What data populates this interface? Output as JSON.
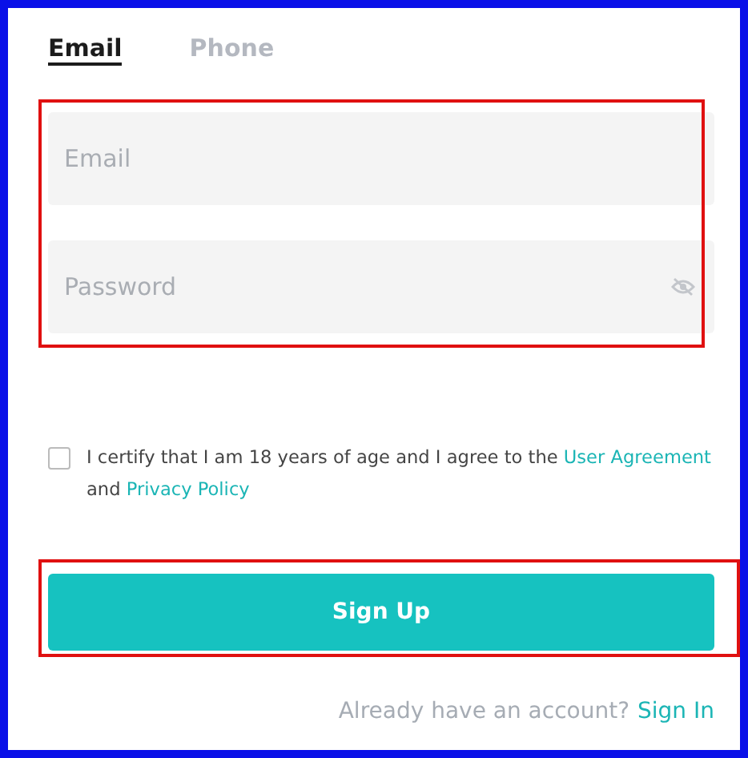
{
  "tabs": [
    {
      "label": "Email",
      "selected": true
    },
    {
      "label": "Phone",
      "selected": false
    }
  ],
  "fields": [
    {
      "placeholder": "Email",
      "kind": "text"
    },
    {
      "placeholder": "Password",
      "kind": "password"
    }
  ],
  "agreement": {
    "checked": false,
    "text": "I certify that I am 18 years of age and I agree to the ",
    "link1": "User Agreement",
    "middle": " and ",
    "link2": "Privacy Policy"
  },
  "submit": "Sign Up",
  "footer": {
    "text": "Already have an account?",
    "link": "Sign In"
  }
}
